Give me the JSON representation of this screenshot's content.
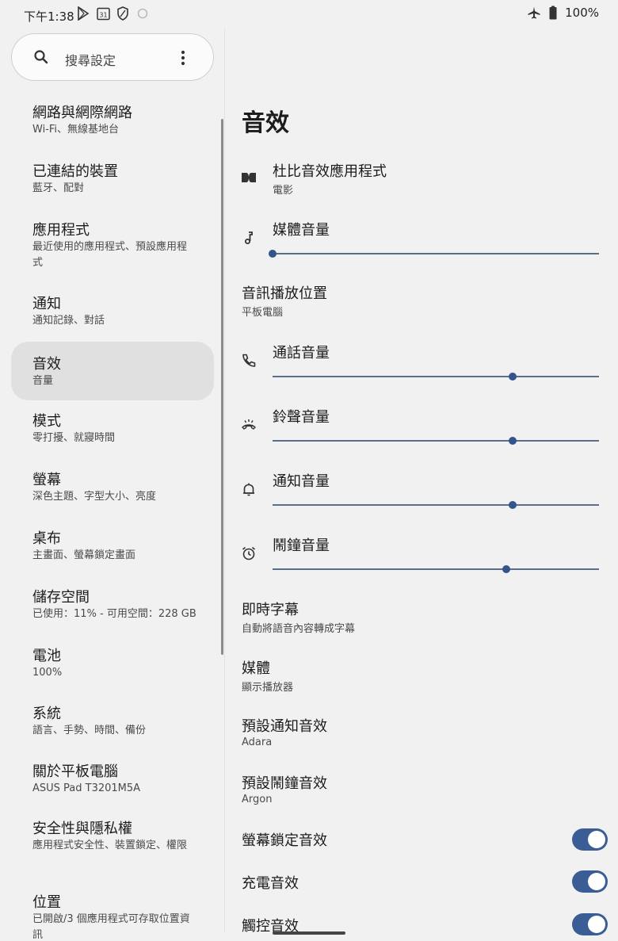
{
  "status_bar": {
    "time": "下午1:38",
    "calendar_day": "31",
    "battery": "100%"
  },
  "search": {
    "placeholder": "搜尋設定"
  },
  "nav": {
    "items": [
      {
        "title": "網路與網際網路",
        "subtitle": "Wi-Fi、無線基地台",
        "selected": false
      },
      {
        "title": "已連結的裝置",
        "subtitle": "藍牙、配對",
        "selected": false
      },
      {
        "title": "應用程式",
        "subtitle": "最近使用的應用程式、預設應用程式",
        "selected": false
      },
      {
        "title": "通知",
        "subtitle": "通知記錄、對話",
        "selected": false
      },
      {
        "title": "音效",
        "subtitle": "音量",
        "selected": true
      },
      {
        "title": "模式",
        "subtitle": "零打擾、就寢時間",
        "selected": false
      },
      {
        "title": "螢幕",
        "subtitle": "深色主題、字型大小、亮度",
        "selected": false
      },
      {
        "title": "桌布",
        "subtitle": "主畫面、螢幕鎖定畫面",
        "selected": false
      },
      {
        "title": "儲存空間",
        "subtitle": "已使用：11% - 可用空間：228 GB",
        "selected": false
      },
      {
        "title": "電池",
        "subtitle": "100%",
        "selected": false
      },
      {
        "title": "系統",
        "subtitle": "語言、手勢、時間、備份",
        "selected": false
      },
      {
        "title": "關於平板電腦",
        "subtitle": "ASUS Pad T3201M5A",
        "selected": false
      },
      {
        "title": "安全性與隱私權",
        "subtitle": "應用程式安全性、裝置鎖定、權限",
        "selected": false
      },
      {
        "title": "位置",
        "subtitle": "已開啟/3 個應用程式可存取位置資訊",
        "selected": false
      }
    ]
  },
  "main": {
    "title": "音效",
    "dolby": {
      "title": "杜比音效應用程式",
      "subtitle": "電影"
    },
    "media_volume": {
      "title": "媒體音量",
      "level": 0.0
    },
    "audio_output": {
      "title": "音訊播放位置",
      "subtitle": "平板電腦"
    },
    "call_volume": {
      "title": "通話音量",
      "level": 0.735
    },
    "ring_volume": {
      "title": "鈴聲音量",
      "level": 0.735
    },
    "notification_volume": {
      "title": "通知音量",
      "level": 0.735
    },
    "alarm_volume": {
      "title": "鬧鐘音量",
      "level": 0.715
    },
    "live_caption": {
      "title": "即時字幕",
      "subtitle": "自動將語音內容轉成字幕"
    },
    "media": {
      "title": "媒體",
      "subtitle": "顯示播放器"
    },
    "default_notification_sound": {
      "title": "預設通知音效",
      "subtitle": "Adara"
    },
    "default_alarm_sound": {
      "title": "預設鬧鐘音效",
      "subtitle": "Argon"
    },
    "screen_lock_sound": {
      "title": "螢幕鎖定音效",
      "on": true
    },
    "charging_sound": {
      "title": "充電音效",
      "on": true
    },
    "touch_sound": {
      "title": "觸控音效",
      "on": true
    }
  },
  "colors": {
    "accent": "#34558b",
    "background": "#f1f1f1",
    "selected_item": "#e0e0e0"
  }
}
